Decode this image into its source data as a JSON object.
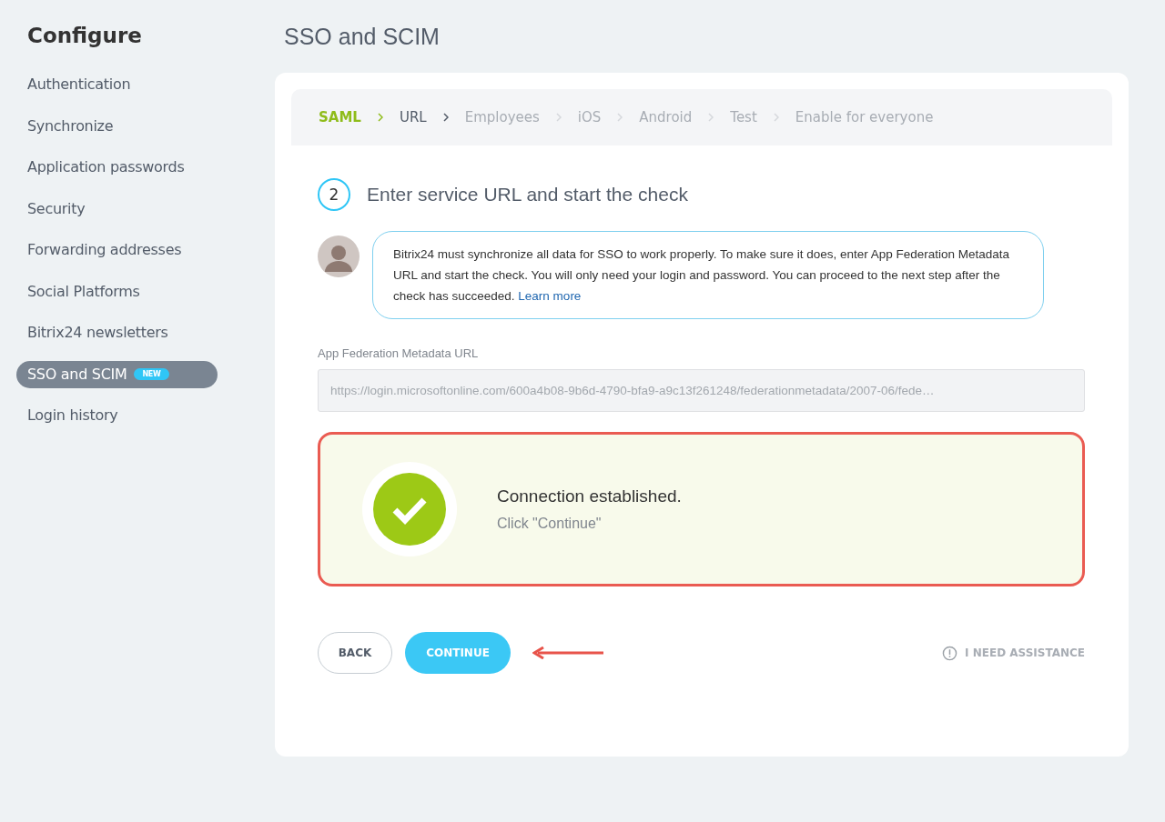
{
  "sidebar": {
    "title": "Configure",
    "items": [
      {
        "label": "Authentication",
        "selected": false
      },
      {
        "label": "Synchronize",
        "selected": false
      },
      {
        "label": "Application passwords",
        "selected": false
      },
      {
        "label": "Security",
        "selected": false
      },
      {
        "label": "Forwarding addresses",
        "selected": false
      },
      {
        "label": "Social Platforms",
        "selected": false
      },
      {
        "label": "Bitrix24 newsletters",
        "selected": false
      },
      {
        "label": "SSO and SCIM",
        "selected": true,
        "badge": "NEW"
      },
      {
        "label": "Login history",
        "selected": false
      }
    ]
  },
  "page_title": "SSO and SCIM",
  "steps": [
    {
      "label": "SAML",
      "kind": "done"
    },
    {
      "label": "URL",
      "kind": "current"
    },
    {
      "label": "Employees",
      "kind": "pending"
    },
    {
      "label": "iOS",
      "kind": "pending"
    },
    {
      "label": "Android",
      "kind": "pending"
    },
    {
      "label": "Test",
      "kind": "pending"
    },
    {
      "label": "Enable for everyone",
      "kind": "pending"
    }
  ],
  "step_number": "2",
  "step_title": "Enter service URL and start the check",
  "hint": {
    "text": "Bitrix24 must synchronize all data for SSO to work properly. To make sure it does, enter App Federation Metadata URL and start the check. You will only need your login and password. You can proceed to the next step after the check has succeeded.",
    "link": "Learn more"
  },
  "url_field": {
    "label": "App Federation Metadata URL",
    "value": "https://login.microsoftonline.com/600a4b08-9b6d-4790-bfa9-a9c13f261248/federationmetadata/2007-06/fede…",
    "disabled": true
  },
  "result": {
    "title": "Connection established.",
    "subtitle": "Click \"Continue\""
  },
  "buttons": {
    "back": "BACK",
    "continue": "CONTINUE"
  },
  "assistance": "I NEED ASSISTANCE"
}
